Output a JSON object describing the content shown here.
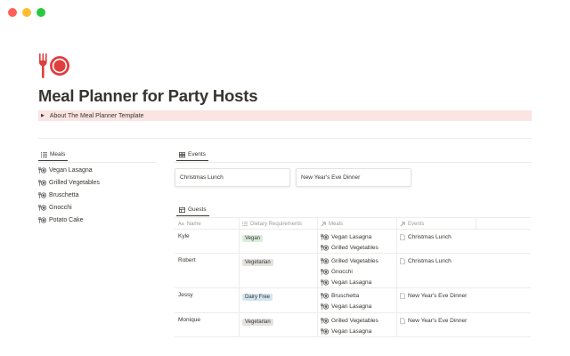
{
  "page": {
    "title": "Meal Planner for Party Hosts",
    "toggle_label": "About The Meal Planner Template",
    "icon": "fork-and-plate-icon"
  },
  "colors": {
    "accent_red": "#e03e3e",
    "toggle_bg": "#fbe4e4",
    "tag_green": "#dbeddb",
    "tag_gray": "#e3e2e0",
    "tag_blue": "#d3e5ef"
  },
  "meals": {
    "header": "Meals",
    "items": [
      "Vegan Lasagna",
      "Grilled Vegetables",
      "Bruschetta",
      "Gnocchi",
      "Potato Cake"
    ]
  },
  "events": {
    "header": "Events",
    "cards": [
      "Christmas Lunch",
      "New Year's Eve Dinner"
    ]
  },
  "guests": {
    "header": "Guests",
    "columns": {
      "name": "Name",
      "name_prefix": "Aa",
      "dietary": "Dietary Requirements",
      "meals": "Meals",
      "events": "Events"
    },
    "rows": [
      {
        "name": "Kyle",
        "dietary": "Vegan",
        "dietary_color": "green",
        "meals": [
          "Vegan Lasagna",
          "Grilled Vegetables"
        ],
        "events": [
          "Christmas Lunch"
        ]
      },
      {
        "name": "Robert",
        "dietary": "Vegetarian",
        "dietary_color": "gray",
        "meals": [
          "Grilled Vegetables",
          "Gnocchi",
          "Vegan Lasagna"
        ],
        "events": [
          "Christmas Lunch"
        ]
      },
      {
        "name": "Jessy",
        "dietary": "Dairy Free",
        "dietary_color": "blue",
        "meals": [
          "Bruschetta",
          "Vegan Lasagna"
        ],
        "events": [
          "New Year's Eve Dinner"
        ]
      },
      {
        "name": "Monique",
        "dietary": "Vegetarian",
        "dietary_color": "gray",
        "meals": [
          "Grilled Vegetables",
          "Vegan Lasagna"
        ],
        "events": [
          "New Year's Eve Dinner"
        ]
      }
    ]
  }
}
